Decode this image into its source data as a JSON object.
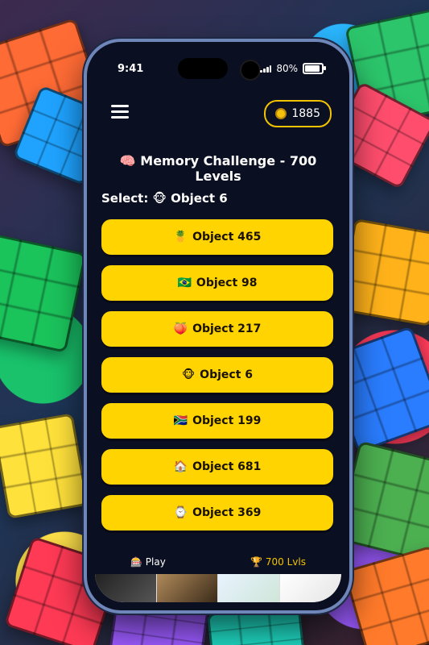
{
  "status": {
    "time": "9:41",
    "battery": "80%"
  },
  "header": {
    "coins": "1885"
  },
  "title": {
    "emoji": "🧠",
    "text": "Memory Challenge - 700 Levels"
  },
  "select": {
    "label": "Select:",
    "emoji": "🐵",
    "target": "Object 6"
  },
  "options": [
    {
      "emoji": "🍍",
      "label": "Object 465"
    },
    {
      "emoji": "🇧🇷",
      "label": "Object 98"
    },
    {
      "emoji": "🍑",
      "label": "Object 217"
    },
    {
      "emoji": "🐵",
      "label": "Object 6"
    },
    {
      "emoji": "🇿🇦",
      "label": "Object 199"
    },
    {
      "emoji": "🏠",
      "label": "Object 681"
    },
    {
      "emoji": "⌚",
      "label": "Object 369"
    }
  ],
  "nav": {
    "play_icon": "🎰",
    "play": "Play",
    "levels_icon": "🏆",
    "levels": "700 Lvls"
  }
}
